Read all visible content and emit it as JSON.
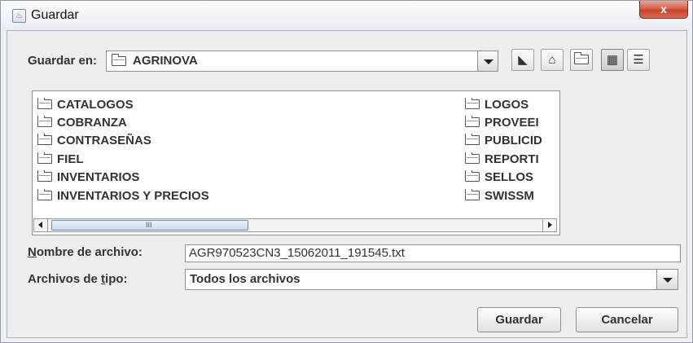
{
  "window": {
    "title": "Guardar",
    "close_label": "x"
  },
  "toolbar": {
    "look_in_label": "Guardar en:",
    "look_in_value": "AGRINOVA",
    "buttons": [
      "up-one-level",
      "home",
      "create-new-folder",
      "list-view",
      "details-view"
    ]
  },
  "file_list": {
    "items_col1": [
      "CATALOGOS",
      "COBRANZA",
      "CONTRASEÑAS",
      "FIEL",
      "INVENTARIOS",
      "INVENTARIOS Y PRECIOS"
    ],
    "items_col2": [
      "LOGOS",
      "PROVEEI",
      "PUBLICID",
      "REPORTI",
      "SELLOS",
      "SWISSM"
    ],
    "scroll_grip": "III"
  },
  "filename": {
    "label_mn": "N",
    "label_rest": "ombre de archivo:",
    "value": "AGR970523CN3_15062011_191545.txt"
  },
  "filetype": {
    "label_pre": "Archivos de ",
    "label_mn": "t",
    "label_post": "ipo:",
    "value": "Todos los archivos"
  },
  "buttons": {
    "save": "Guardar",
    "cancel": "Cancelar"
  }
}
